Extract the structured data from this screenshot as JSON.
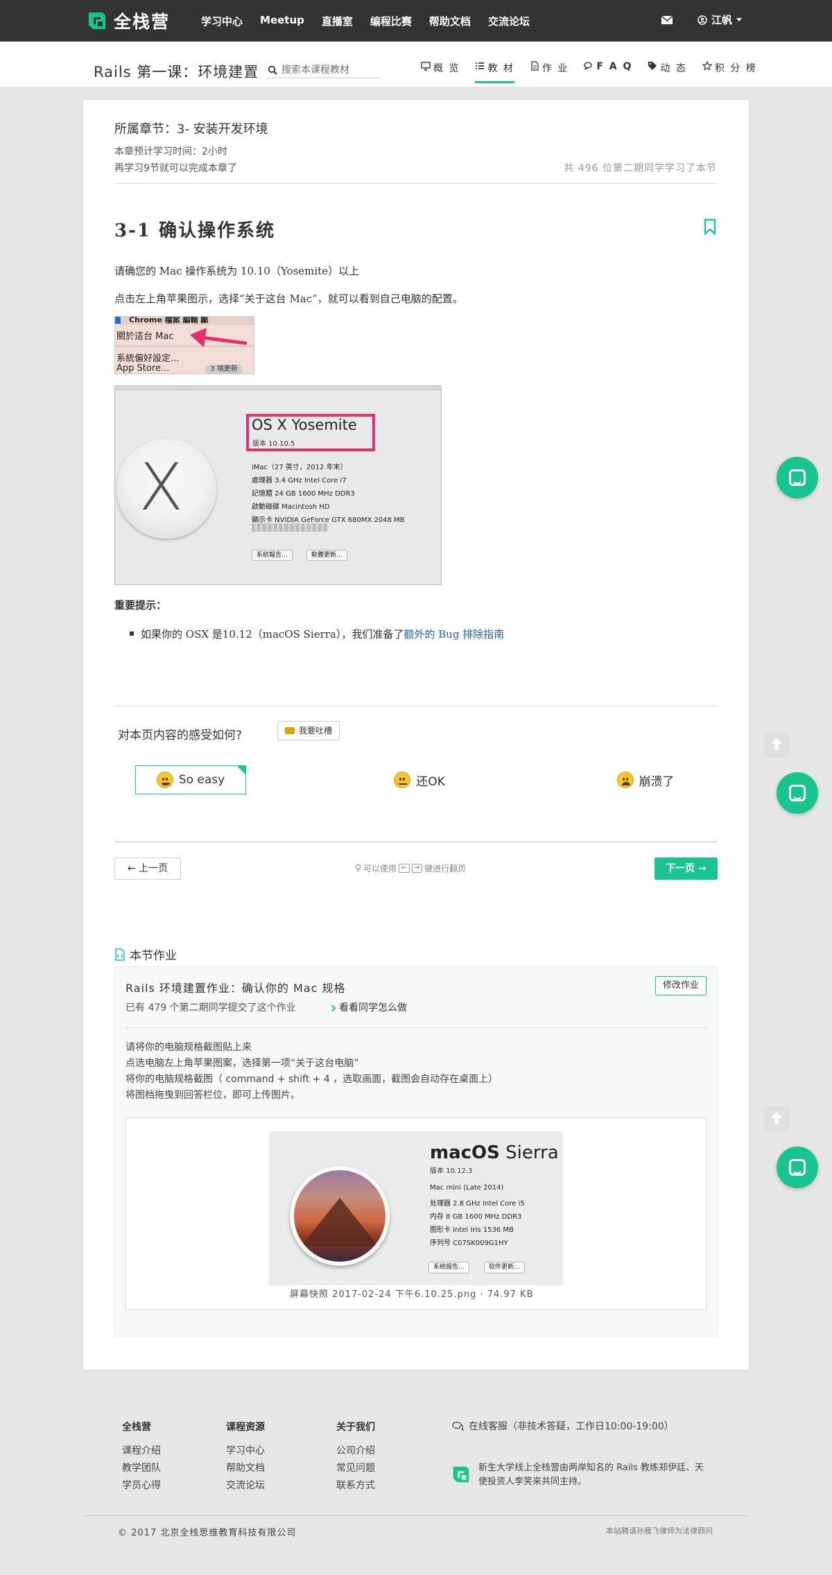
{
  "colors": {
    "accent": "#19c58f",
    "topbar": "#333333",
    "link": "#1f5fb8",
    "highlight": "#e6306b"
  },
  "topnav": {
    "brand": "全栈营",
    "links": [
      "学习中心",
      "Meetup",
      "直播室",
      "编程比赛",
      "帮助文档",
      "交流论坛"
    ],
    "user": "江帆",
    "icons": {
      "mail": "envelope-icon",
      "user": "user-circle-icon"
    }
  },
  "subnav": {
    "course_title": "Rails 第一课：环境建置",
    "search_placeholder": "搜索本课程教材",
    "tabs": [
      {
        "label": "概 览",
        "icon": "desktop-icon"
      },
      {
        "label": "教 材",
        "icon": "list-icon",
        "active": true
      },
      {
        "label": "作 业",
        "icon": "file-icon"
      },
      {
        "label": "F A Q",
        "icon": "chat-icon"
      },
      {
        "label": "动 态",
        "icon": "tags-icon"
      },
      {
        "label": "积 分 榜",
        "icon": "star-icon"
      }
    ]
  },
  "chapter": {
    "label": "所属章节：3- 安装开发环境",
    "study_time": "本章预计学习时间：2小时",
    "remaining": "再学习9节就可以完成本章了",
    "peers": "共 496 位第二期同学学习了本节"
  },
  "lesson": {
    "title": "3-1 确认操作系统",
    "p1": "请确您的 Mac 操作系统为 10.10（Yosemite）以上",
    "p2": "点击左上角苹果图示，选择“关于这台 Mac”，就可以看到自己电脑的配置。",
    "menu_shot": {
      "menubar": "Chrome    檔案    編輯    顯",
      "item1": "關於這台 Mac",
      "item2": "系統偏好設定...",
      "item3": "App Store...",
      "badge": "3 項更新"
    },
    "about_shot": {
      "os": "OS X Yosemite",
      "version": "版本 10.10.5",
      "specs": [
        "iMac（27 英寸，2012 年末）",
        "處理器  3.4 GHz Intel Core i7",
        "記憶體  24 GB 1600 MHz DDR3",
        "啟動磁碟  Macintosh HD",
        "顯示卡  NVIDIA GeForce GTX 680MX 2048 MB"
      ],
      "btn1": "系統報告...",
      "btn2": "軟體更新..."
    },
    "tip_title": "重要提示：",
    "tip_text": "如果你的 OSX 是10.12（macOS Sierra），我们准备了",
    "tip_link": "额外的 Bug 排除指南"
  },
  "feedback": {
    "question": "对本页内容的感受如何?",
    "complain": "我要吐槽",
    "options": [
      "So easy",
      "还OK",
      "崩溃了"
    ]
  },
  "pager": {
    "prev": "上一页",
    "hint_pre": "可以使用",
    "hint_post": "键进行翻页",
    "next": "下一页"
  },
  "homework": {
    "section": "本节作业",
    "title": "Rails 环境建置作业：确认你的 Mac 规格",
    "edit": "修改作业",
    "submitted": "已有 479 个第二期同学提交了这个作业",
    "view": "看看同学怎么做",
    "lines": [
      "请将你的电脑规格截图贴上来",
      "点选电脑左上角苹果图案，选择第一项“关于这台电脑”",
      "将你的电脑规格截图（ command + shift + 4 ，选取画面，截图会自动存在桌面上）",
      "将图档拖曳到回答栏位，即可上传图片。"
    ],
    "sierra": {
      "os_bold": "macOS",
      "os_light": " Sierra",
      "version": "版本 10.12.3",
      "specs": [
        "Mac mini (Late 2014)",
        "处理器  2.8 GHz Intel Core i5",
        "内存  8 GB 1600 MHz DDR3",
        "图形卡  Intel Iris 1536 MB",
        "序列号  C07SK009G1HY"
      ],
      "btn1": "系统报告...",
      "btn2": "软件更新..."
    },
    "caption": "屏幕快照 2017-02-24 下午6.10.25.png · 74.97 KB"
  },
  "footer": {
    "cols": [
      {
        "title": "全栈营",
        "items": [
          "课程介绍",
          "教学团队",
          "学员心得"
        ]
      },
      {
        "title": "课程资源",
        "items": [
          "学习中心",
          "帮助文档",
          "交流论坛"
        ]
      },
      {
        "title": "关于我们",
        "items": [
          "公司介绍",
          "常见问题",
          "联系方式"
        ]
      }
    ],
    "service": "在线客服（非技术答疑，工作日10:00-19:00）",
    "slogan": "新生大学线上全栈营由两岸知名的 Rails 教练郑伊廷、天使投资人李笑来共同主持。",
    "copyright": "© 2017 北京全栈思维教育科技有限公司",
    "lawyer": "本站聘请孙雁飞律师为法律顾问"
  }
}
